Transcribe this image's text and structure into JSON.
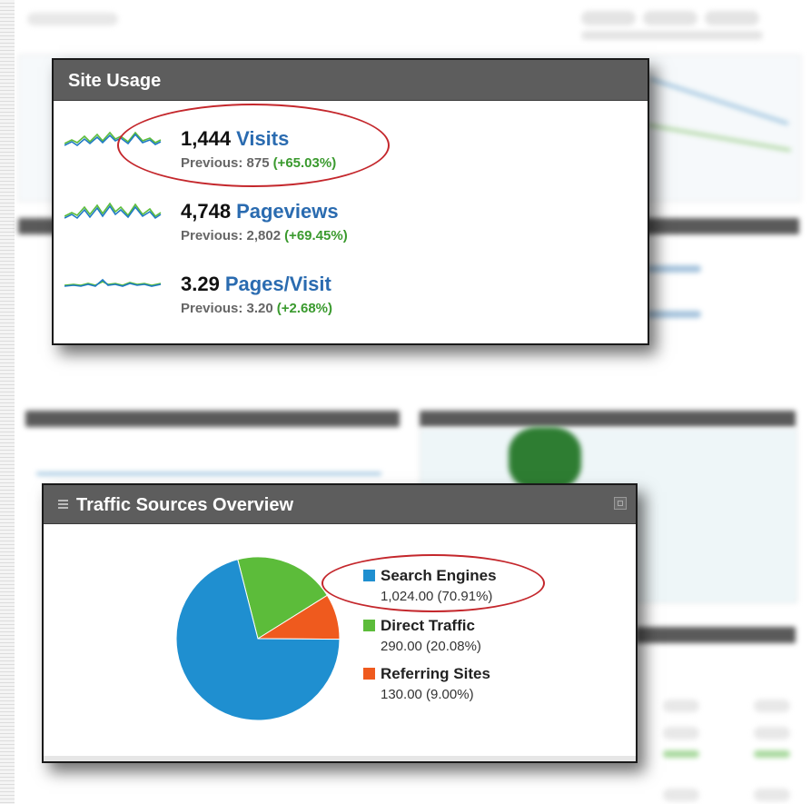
{
  "site_usage": {
    "title": "Site Usage",
    "metrics": [
      {
        "value": "1,444",
        "label": "Visits",
        "previous": "Previous: 875",
        "change": "(+65.03%)"
      },
      {
        "value": "4,748",
        "label": "Pageviews",
        "previous": "Previous: 2,802",
        "change": "(+69.45%)"
      },
      {
        "value": "3.29",
        "label": "Pages/Visit",
        "previous": "Previous: 3.20",
        "change": "(+2.68%)"
      }
    ]
  },
  "traffic_sources": {
    "title": "Traffic Sources Overview",
    "sources": [
      {
        "name": "Search Engines",
        "value": "1,024.00 (70.91%)",
        "share": 70.91,
        "color": "#1f8fd0"
      },
      {
        "name": "Direct Traffic",
        "value": "290.00 (20.08%)",
        "share": 20.08,
        "color": "#5cbc3a"
      },
      {
        "name": "Referring Sites",
        "value": "130.00 (9.00%)",
        "share": 9.0,
        "color": "#ef5a1e"
      }
    ]
  },
  "colors": {
    "highlight": "#c4272c",
    "header": "#5d5d5d",
    "link": "#2a6bb0",
    "positive": "#3a9a2e"
  }
}
